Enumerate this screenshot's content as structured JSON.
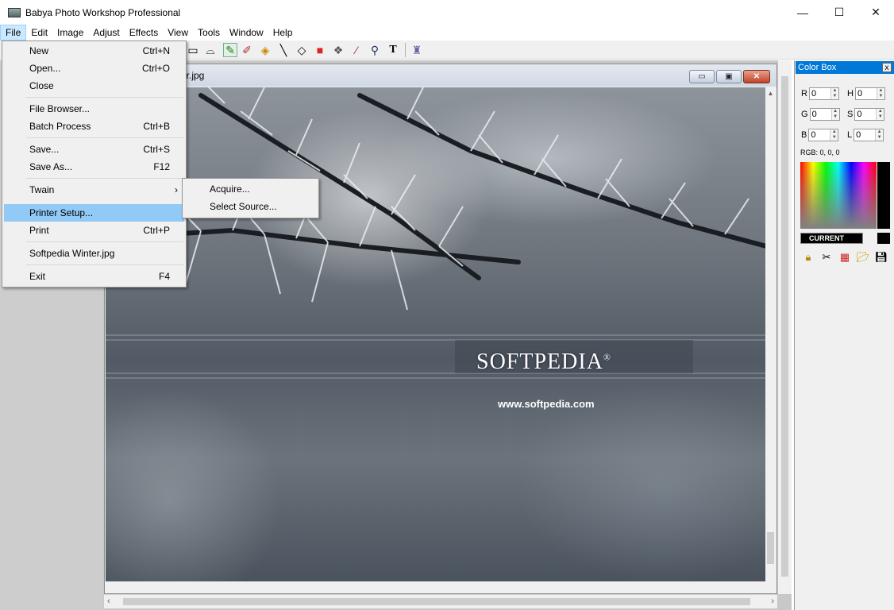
{
  "window": {
    "title": "Babya Photo Workshop Professional",
    "minimize": "—",
    "maximize": "☐",
    "close": "✕"
  },
  "menubar": [
    "File",
    "Edit",
    "Image",
    "Adjust",
    "Effects",
    "View",
    "Tools",
    "Window",
    "Help"
  ],
  "file_menu": {
    "new": {
      "label": "New",
      "shortcut": "Ctrl+N"
    },
    "open": {
      "label": "Open...",
      "shortcut": "Ctrl+O"
    },
    "close": {
      "label": "Close",
      "shortcut": ""
    },
    "file_browser": {
      "label": "File Browser...",
      "shortcut": ""
    },
    "batch": {
      "label": "Batch Process",
      "shortcut": "Ctrl+B"
    },
    "save": {
      "label": "Save...",
      "shortcut": "Ctrl+S"
    },
    "save_as": {
      "label": "Save As...",
      "shortcut": "F12"
    },
    "twain": {
      "label": "Twain",
      "shortcut": "›"
    },
    "printer_setup": {
      "label": "Printer Setup...",
      "shortcut": ""
    },
    "print": {
      "label": "Print",
      "shortcut": "Ctrl+P"
    },
    "recent": {
      "label": "Softpedia Winter.jpg",
      "shortcut": ""
    },
    "exit": {
      "label": "Exit",
      "shortcut": "F4"
    }
  },
  "twain_submenu": {
    "acquire": "Acquire...",
    "select_source": "Select Source..."
  },
  "document": {
    "title": "er.jpg",
    "logo": "SOFTPEDIA",
    "registered": "®",
    "url": "www.softpedia.com",
    "min": "▭",
    "max": "▣",
    "close": "✕"
  },
  "colorbox": {
    "title": "Color Box",
    "close": "x",
    "r": {
      "label": "R",
      "value": "0"
    },
    "h": {
      "label": "H",
      "value": "0"
    },
    "g": {
      "label": "G",
      "value": "0"
    },
    "s": {
      "label": "S",
      "value": "0"
    },
    "b": {
      "label": "B",
      "value": "0"
    },
    "l": {
      "label": "L",
      "value": "0"
    },
    "rgb_text": "RGB: 0, 0, 0",
    "current": "CURRENT",
    "current_color": "#000000"
  },
  "icons": [
    "rectangle-select-icon",
    "lasso-icon",
    "pencil-icon",
    "brush-icon",
    "fill-icon",
    "line-icon",
    "eraser-icon",
    "color-picker-icon",
    "stamp-icon",
    "eyedropper-icon",
    "zoom-icon",
    "text-icon",
    "smudge-icon"
  ]
}
